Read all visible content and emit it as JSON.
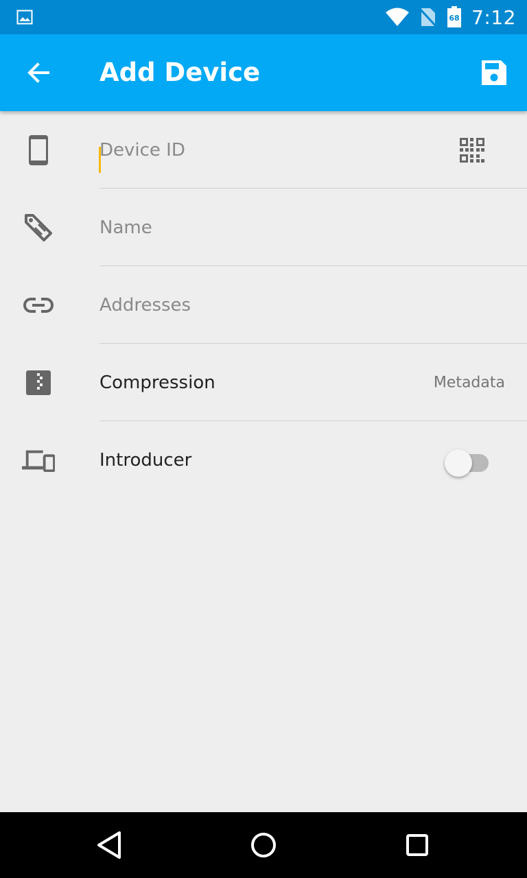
{
  "status_bar": {
    "time": "7:12",
    "battery_level": "68",
    "icons": [
      "image-icon",
      "wifi-icon",
      "no-sim-icon",
      "battery-icon"
    ]
  },
  "app_bar": {
    "title": "Add Device",
    "back_icon": "arrow-back-icon",
    "save_icon": "save-icon",
    "color": "#03a9f4"
  },
  "form": {
    "device_id": {
      "icon": "phone-icon",
      "placeholder": "Device ID",
      "value": "",
      "action_icon": "qr-code-icon"
    },
    "name": {
      "icon": "tag-icon",
      "placeholder": "Name",
      "value": ""
    },
    "addresses": {
      "icon": "link-icon",
      "placeholder": "Addresses",
      "value": ""
    },
    "compression": {
      "icon": "zip-icon",
      "label": "Compression",
      "value": "Metadata"
    },
    "introducer": {
      "icon": "devices-icon",
      "label": "Introducer",
      "enabled": false
    }
  },
  "nav_bar": {
    "icons": [
      "back-triangle-icon",
      "home-circle-icon",
      "recents-square-icon"
    ]
  },
  "colors": {
    "status_bar": "#0288d1",
    "accent_cursor": "#f5b800",
    "background": "#eeeeee"
  }
}
